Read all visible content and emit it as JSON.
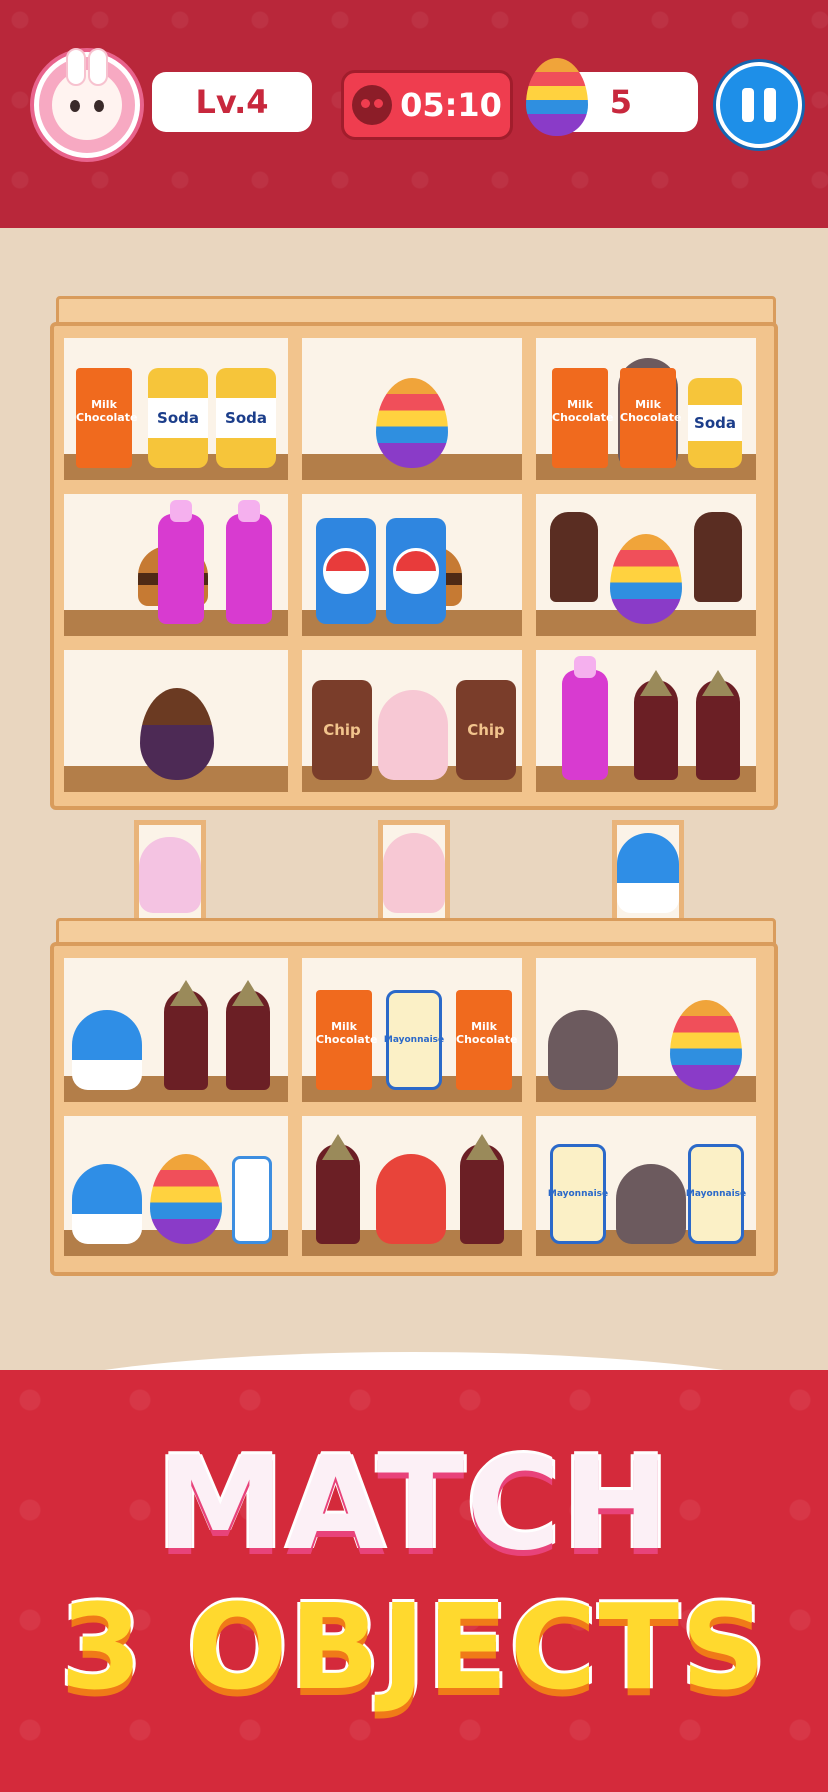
{
  "hud": {
    "level": "Lv.4",
    "timer": "05:10",
    "eggs_collected": "5"
  },
  "items": {
    "milk_box_label": "Milk Chocolate",
    "soda_label": "Soda",
    "chip_label": "Chip",
    "mayo_label": "Mayonnaise"
  },
  "banner": {
    "line1": "MATCH",
    "line2": "3 OBJECTS"
  },
  "colors": {
    "header": "#b9273a",
    "banner": "#d42a3b",
    "pause_button": "#1e8fe8",
    "timer_bg": "#ef3d4f"
  }
}
